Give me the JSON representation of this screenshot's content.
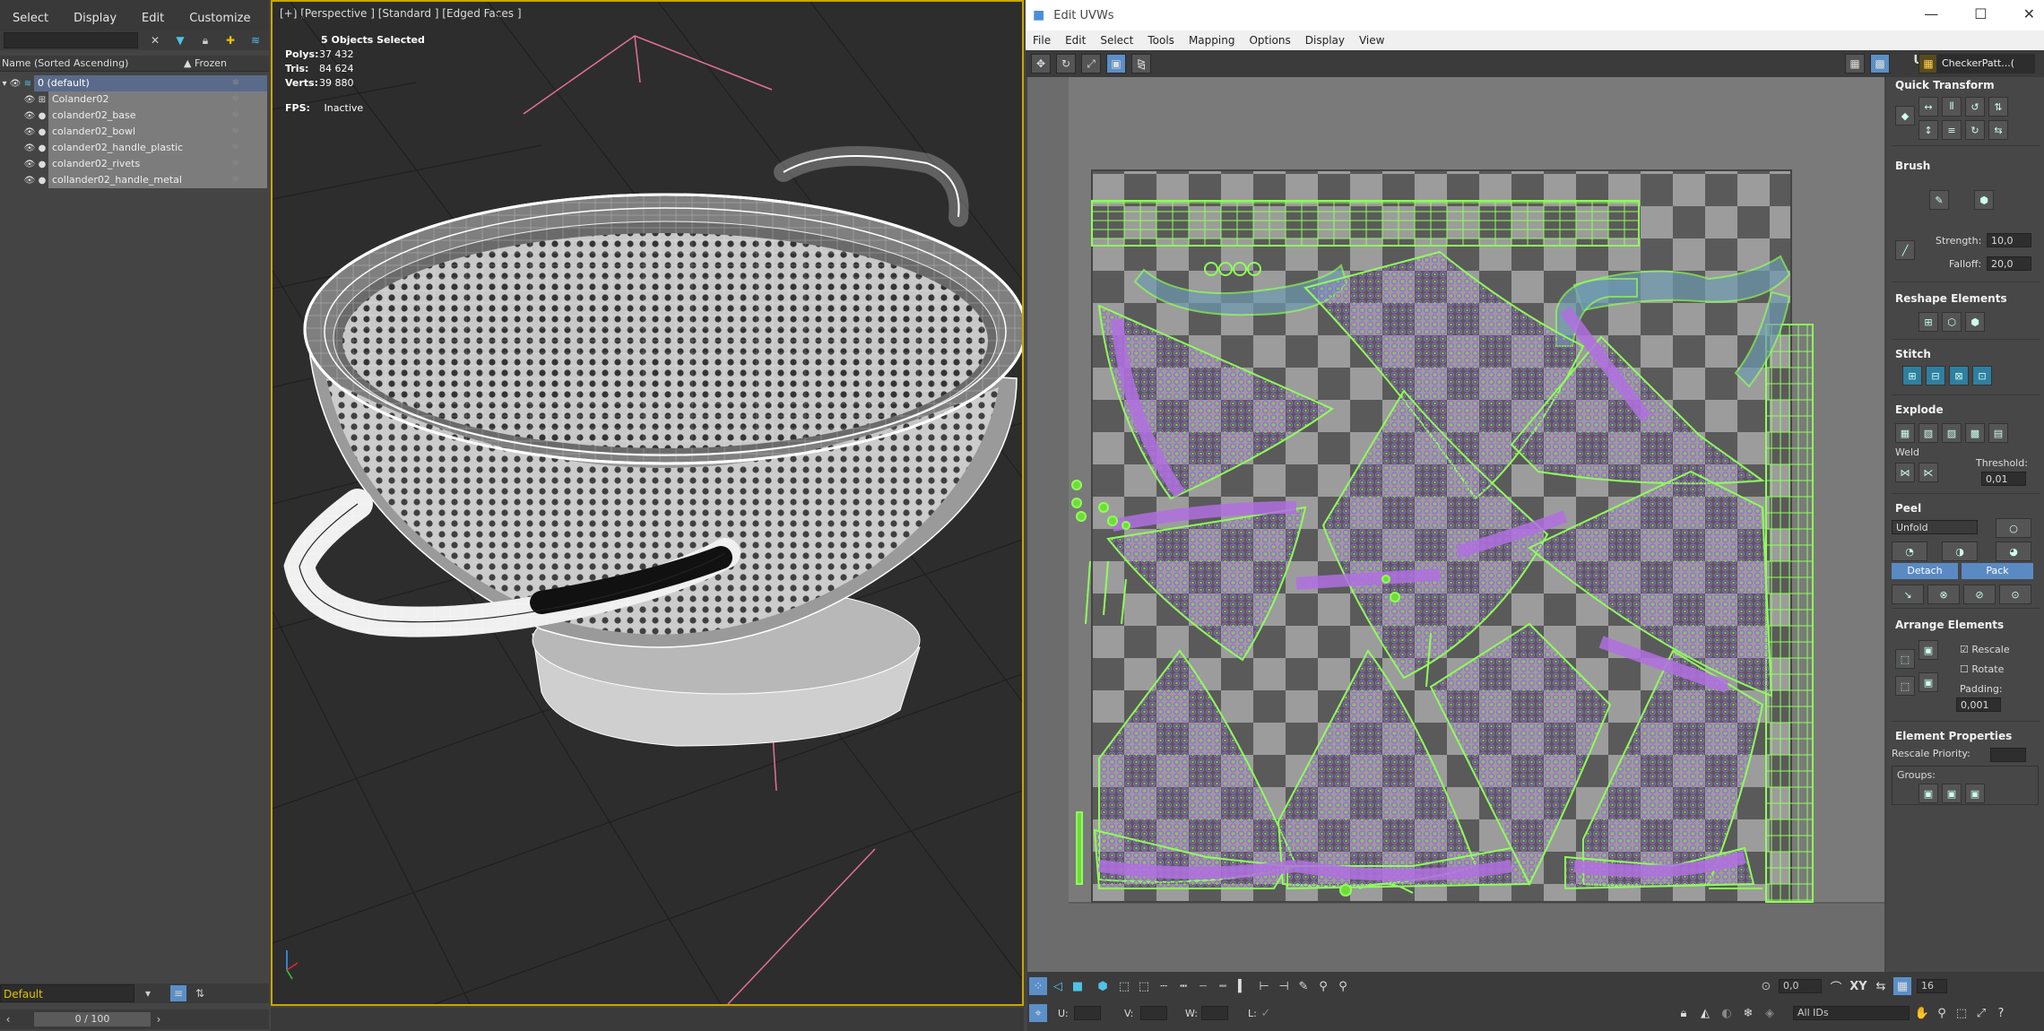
{
  "explorer": {
    "menu": [
      "Select",
      "Display",
      "Edit",
      "Customize"
    ],
    "col_name": "Name (Sorted Ascending)",
    "col_frozen": "▲ Frozen",
    "rows": [
      {
        "label": "0 (default)",
        "indent": 0,
        "type": "layer"
      },
      {
        "label": "Colander02",
        "indent": 1,
        "type": "group"
      },
      {
        "label": "colander02_base",
        "indent": 1,
        "type": "mesh"
      },
      {
        "label": "colander02_bowl",
        "indent": 1,
        "type": "mesh"
      },
      {
        "label": "colander02_handle_plastic",
        "indent": 1,
        "type": "mesh"
      },
      {
        "label": "colander02_rivets",
        "indent": 1,
        "type": "mesh"
      },
      {
        "label": "collander02_handle_metal",
        "indent": 1,
        "type": "mesh"
      }
    ],
    "layer": "Default",
    "time": "0 / 100"
  },
  "viewport": {
    "label": "[+] [Perspective ] [Standard ] [Edged Faces ]",
    "selected": "5 Objects Selected",
    "stats": [
      {
        "k": "Polys:",
        "v": "37 432"
      },
      {
        "k": "Tris:",
        "v": "84 624"
      },
      {
        "k": "Verts:",
        "v": "39 880"
      }
    ],
    "fps_k": "FPS:",
    "fps_v": "Inactive"
  },
  "uv": {
    "title": "Edit UVWs",
    "menu": [
      "File",
      "Edit",
      "Select",
      "Tools",
      "Mapping",
      "Options",
      "Display",
      "View"
    ],
    "uv_label": "UV",
    "map": "CheckerPatt...( Checker )",
    "side": {
      "quick_transform": "Quick Transform",
      "brush": "Brush",
      "strength_lbl": "Strength:",
      "strength": "10,0",
      "falloff_lbl": "Falloff:",
      "falloff": "20,0",
      "reshape": "Reshape Elements",
      "stitch": "Stitch",
      "explode": "Explode",
      "weld": "Weld",
      "threshold_lbl": "Threshold:",
      "threshold": "0,01",
      "peel": "Peel",
      "unfold": "Unfold",
      "detach": "Detach",
      "pack": "Pack",
      "arrange": "Arrange Elements",
      "rescale": "Rescale",
      "rotate": "Rotate",
      "padding_lbl": "Padding:",
      "padding": "0,001",
      "elem_props": "Element Properties",
      "rescale_priority": "Rescale Priority:",
      "groups": "Groups:"
    },
    "bottom": {
      "u": "U:",
      "v": "V:",
      "w": "W:",
      "l": "L:",
      "angle": "0,0",
      "xy": "XY",
      "grid": "16",
      "ids": "All IDs"
    }
  },
  "colors": {
    "accent": "#c8a700",
    "uv_green": "#7dff4a",
    "uv_purple": "#b070e0",
    "blue": "#5a8ac4"
  }
}
